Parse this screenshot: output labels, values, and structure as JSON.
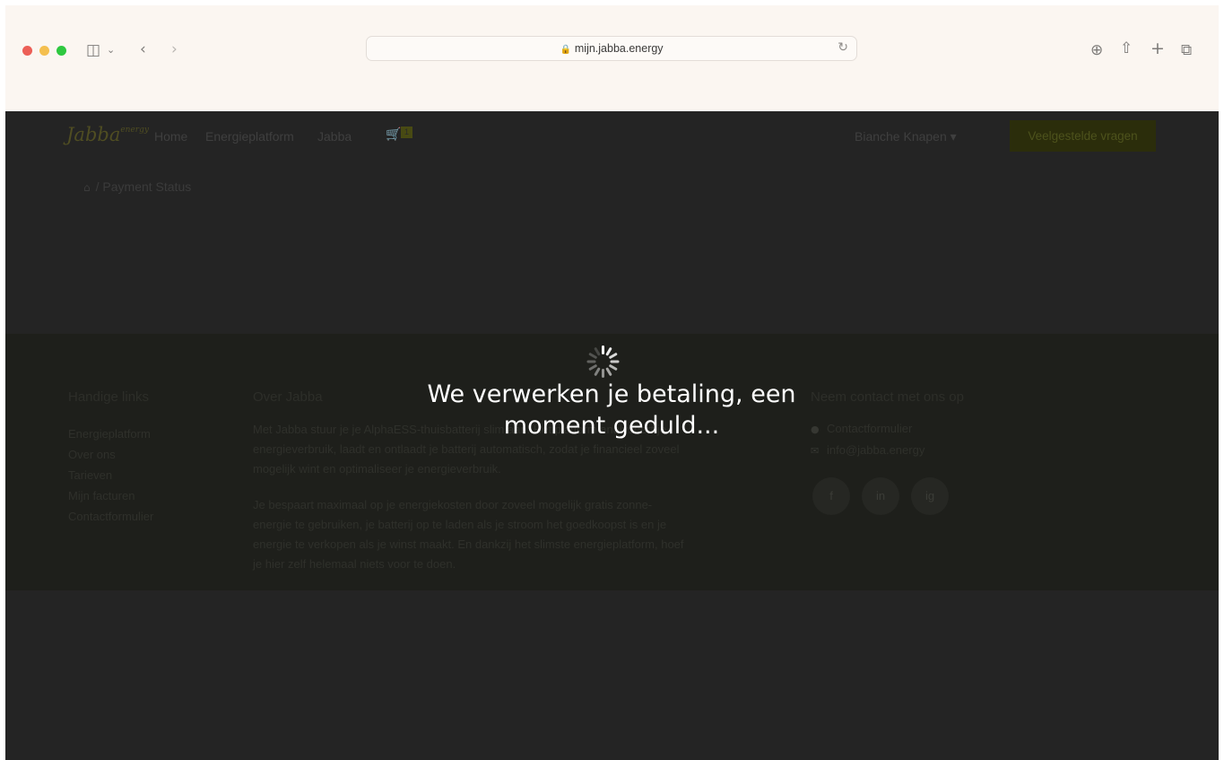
{
  "browser": {
    "url": "mijn.jabba.energy",
    "traffic_colors": [
      "#ec5f57",
      "#f4bf4f",
      "#2ec840"
    ]
  },
  "nav": {
    "logo": "Jabba",
    "logo_suffix": "energy",
    "links": [
      "Home",
      "Energieplatform",
      "Jabba"
    ],
    "cart_count": "1",
    "user": "Bianche Knapen",
    "faq_button": "Veelgestelde vragen"
  },
  "breadcrumb": {
    "current": "Payment Status"
  },
  "footer": {
    "col1": {
      "title": "Handige links",
      "links": [
        "Energieplatform",
        "Over ons",
        "Tarieven",
        "Mijn facturen",
        "Contactformulier"
      ]
    },
    "col2": {
      "title": "Over Jabba",
      "para1": "Met Jabba stuur je je AlphaESS-thuisbatterij slim aan. Het platform analyseert je energieverbruik, laadt en ontlaadt je batterij automatisch, zodat je financieel zoveel mogelijk wint en optimaliseer je energieverbruik.",
      "para2": "Je bespaart maximaal op je energiekosten door zoveel mogelijk gratis zonne-energie te gebruiken, je batterij op te laden als je stroom het goedkoopst is en je energie te verkopen als je winst maakt. En dankzij het slimste energieplatform, hoef je hier zelf helemaal niets voor te doen."
    },
    "col3": {
      "title": "Neem contact met ons op",
      "contact": [
        "Contactformulier",
        "info@jabba.energy"
      ],
      "social": [
        "f",
        "in",
        "ig"
      ]
    }
  },
  "overlay": {
    "message": "We verwerken je betaling, een moment geduld..."
  }
}
